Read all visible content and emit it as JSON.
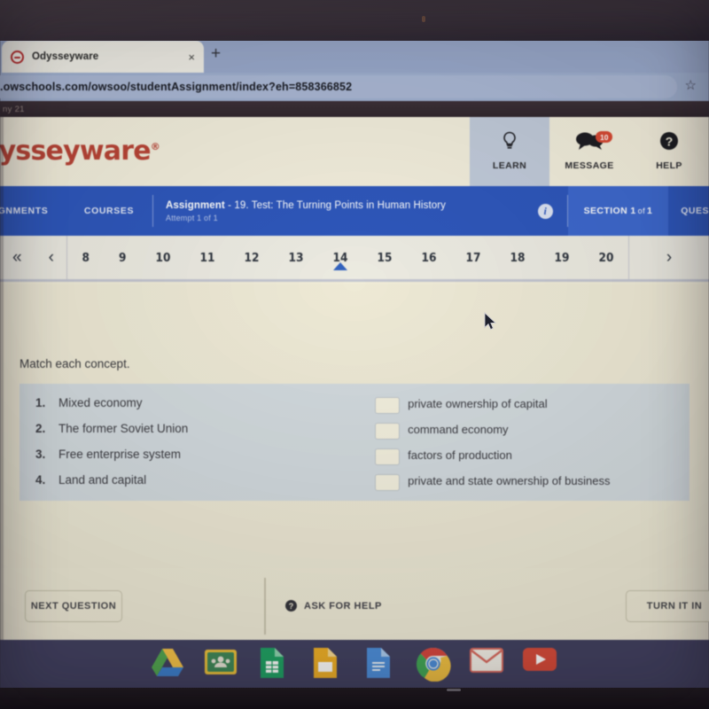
{
  "browser": {
    "tab": {
      "title": "Odysseyware",
      "favicon": "odysseyware-favicon",
      "close": "×"
    },
    "new_tab": "+",
    "url": ".owschools.com/owsoo/studentAssignment/index?eh=858366852",
    "bookmark_icon": "☆"
  },
  "os": {
    "date_strip": "ny 21"
  },
  "site": {
    "logo": "dysseyware",
    "logo_mark": "®",
    "header_buttons": [
      {
        "label": "LEARN",
        "icon": "lightbulb-icon",
        "glyph": "☉",
        "active": true,
        "badge": null
      },
      {
        "label": "MESSAGE",
        "icon": "speech-bubble-icon",
        "glyph": "●",
        "active": false,
        "badge": "10"
      },
      {
        "label": "HELP",
        "icon": "question-circle-icon",
        "glyph": "?",
        "active": false,
        "badge": null
      }
    ]
  },
  "assignment_nav": {
    "assignments_label": "GNMENTS",
    "courses_label": "COURSES",
    "title_prefix": "Assignment",
    "title_rest": " - 19. Test: The Turning Points in Human History",
    "attempt": "Attempt 1 of 1",
    "info_icon": "info-icon",
    "info_glyph": "i",
    "section_label": "SECTION",
    "section_current": "1",
    "section_of": "of",
    "section_total": "1",
    "question_label": "QUES"
  },
  "pager": {
    "first_arrow": "«",
    "prev_arrow": "‹",
    "next_arrow": "›",
    "numbers": [
      "8",
      "9",
      "10",
      "11",
      "12",
      "13",
      "14",
      "15",
      "16",
      "17",
      "18",
      "19",
      "20"
    ],
    "current": "14"
  },
  "question": {
    "prompt": "Match each concept.",
    "concepts": [
      {
        "num": "1.",
        "text": "Mixed economy"
      },
      {
        "num": "2.",
        "text": "The former Soviet Union"
      },
      {
        "num": "3.",
        "text": "Free enterprise system"
      },
      {
        "num": "4.",
        "text": "Land and capital"
      }
    ],
    "answers": [
      {
        "text": "private ownership of capital",
        "value": ""
      },
      {
        "text": "command economy",
        "value": ""
      },
      {
        "text": "factors of production",
        "value": ""
      },
      {
        "text": "private and state ownership of business",
        "value": ""
      }
    ]
  },
  "actions": {
    "next_question": "NEXT QUESTION",
    "ask_for_help": "ASK FOR HELP",
    "ask_icon": "question-mark-icon",
    "ask_glyph": "?",
    "turn_it_in": "TURN IT IN"
  },
  "taskbar": {
    "items": [
      {
        "name": "google-drive-icon",
        "label": "Drive"
      },
      {
        "name": "google-classroom-icon",
        "label": "Classroom"
      },
      {
        "name": "google-sheets-icon",
        "label": "Sheets"
      },
      {
        "name": "google-slides-icon",
        "label": "Slides"
      },
      {
        "name": "google-docs-icon",
        "label": "Docs"
      },
      {
        "name": "google-chrome-icon",
        "label": "Chrome"
      },
      {
        "name": "gmail-icon",
        "label": "Gmail"
      },
      {
        "name": "youtube-icon",
        "label": "YouTube"
      }
    ]
  },
  "colors": {
    "brand_red": "#bf4233",
    "nav_blue": "#2b57c4",
    "page_cream": "#eeead6",
    "match_panel": "#d3dbe0",
    "badge_red": "#e0472f"
  }
}
